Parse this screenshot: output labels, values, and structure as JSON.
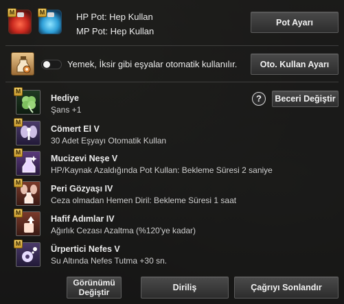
{
  "pots": {
    "hp_line": "HP Pot: Hep Kullan",
    "mp_line": "MP Pot: Hep Kullan",
    "button": "Pot Ayarı"
  },
  "auto_use": {
    "enabled": false,
    "text": "Yemek, İksir gibi eşyalar otomatik kullanılır.",
    "button": "Oto. Kullan Ayarı"
  },
  "skill_change_button": "Beceri Değiştir",
  "help_label": "?",
  "badge": "M",
  "skills": [
    {
      "icon": "clover-icon",
      "title": "Hediye",
      "desc": "Şans +1"
    },
    {
      "icon": "fairy-icon",
      "title": "Cömert El V",
      "desc": "30 Adet Eşyayı Otomatik Kullan"
    },
    {
      "icon": "potion-sparkle-icon",
      "title": "Mucizevi Neşe V",
      "desc": "HP/Kaynak Azaldığında Pot Kullan: Bekleme Süresi 2 saniye"
    },
    {
      "icon": "tear-bottle-icon",
      "title": "Peri Gözyaşı IV",
      "desc": "Ceza olmadan Hemen Diril: Bekleme Süresi 1 saat"
    },
    {
      "icon": "light-steps-icon",
      "title": "Hafif Adımlar IV",
      "desc": "Ağırlık Cezası Azaltma (%120'ye kadar)"
    },
    {
      "icon": "breath-icon",
      "title": "Ürpertici Nefes V",
      "desc": "Su Altında Nefes Tutma +30 sn."
    }
  ],
  "footer": {
    "view_button": "Görünümü Değiştir",
    "revive_button": "Diriliş",
    "end_call_button": "Çağrıyı Sonlandır"
  },
  "colors": {
    "panel_bg": "#121212",
    "button_bg": "#3c3c3c",
    "badge_gold": "#e0b84a",
    "skill_icon_bg": "#3a2f5a"
  }
}
